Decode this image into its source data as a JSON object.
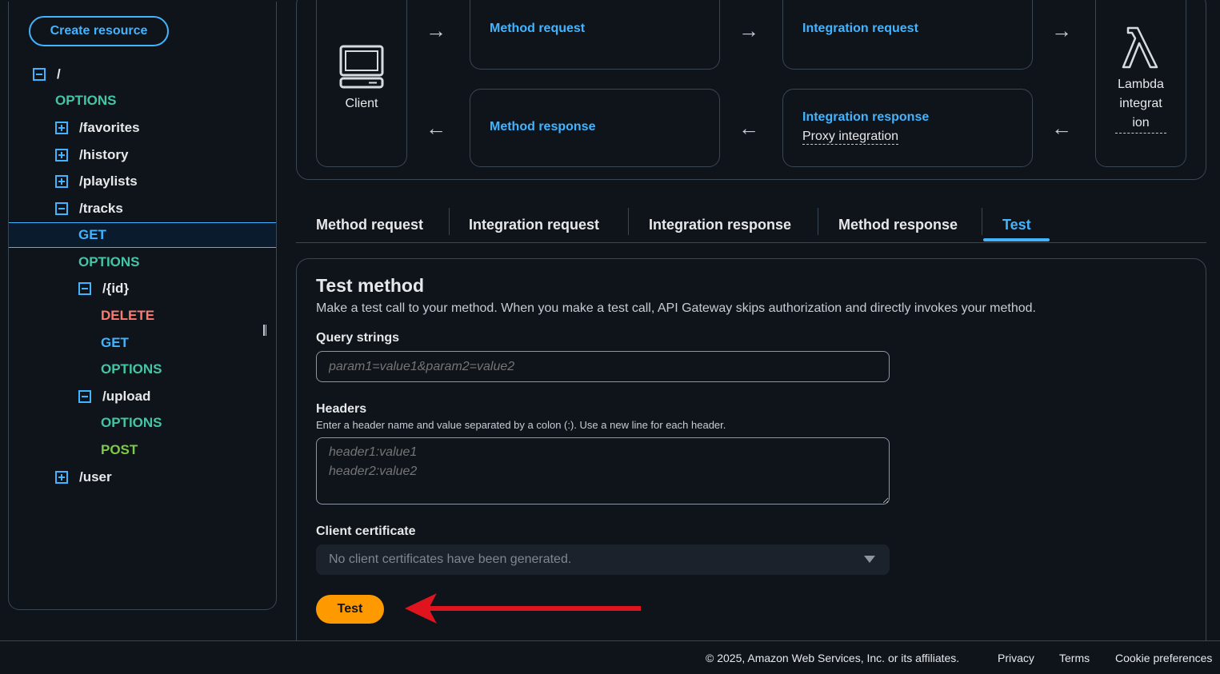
{
  "sidebar": {
    "create_resource": "Create resource",
    "tree": [
      {
        "kind": "path",
        "label": "/",
        "toggle": "minus"
      },
      {
        "kind": "method",
        "label": "OPTIONS",
        "method": "options"
      },
      {
        "kind": "path",
        "label": "/favorites",
        "toggle": "plus"
      },
      {
        "kind": "path",
        "label": "/history",
        "toggle": "plus"
      },
      {
        "kind": "path",
        "label": "/playlists",
        "toggle": "plus"
      },
      {
        "kind": "path",
        "label": "/tracks",
        "toggle": "minus"
      },
      {
        "kind": "method",
        "label": "GET",
        "method": "get",
        "selected": true
      },
      {
        "kind": "method",
        "label": "OPTIONS",
        "method": "options"
      },
      {
        "kind": "path",
        "label": "/{id}",
        "toggle": "minus"
      },
      {
        "kind": "method",
        "label": "DELETE",
        "method": "delete"
      },
      {
        "kind": "method",
        "label": "GET",
        "method": "get"
      },
      {
        "kind": "method",
        "label": "OPTIONS",
        "method": "options"
      },
      {
        "kind": "path",
        "label": "/upload",
        "toggle": "minus"
      },
      {
        "kind": "method",
        "label": "OPTIONS",
        "method": "options"
      },
      {
        "kind": "method",
        "label": "POST",
        "method": "post"
      },
      {
        "kind": "path",
        "label": "/user",
        "toggle": "plus"
      }
    ]
  },
  "flow": {
    "client": "Client",
    "method_request": "Method request",
    "integration_request": "Integration request",
    "method_response": "Method response",
    "integration_response": "Integration response",
    "proxy_integration": "Proxy integration",
    "lambda_line1": "Lambda",
    "lambda_line2": "integrat",
    "lambda_line3": "ion"
  },
  "tabs": [
    {
      "label": "Method request"
    },
    {
      "label": "Integration request"
    },
    {
      "label": "Integration response"
    },
    {
      "label": "Method response"
    },
    {
      "label": "Test",
      "active": true
    }
  ],
  "test_method": {
    "title": "Test method",
    "description": "Make a test call to your method. When you make a test call, API Gateway skips authorization and directly invokes your method.",
    "query_label": "Query strings",
    "query_placeholder": "param1=value1&param2=value2",
    "headers_label": "Headers",
    "headers_hint": "Enter a header name and value separated by a colon (:). Use a new line for each header.",
    "headers_placeholder": "header1:value1\nheader2:value2",
    "cert_label": "Client certificate",
    "cert_value": "No client certificates have been generated.",
    "test_button": "Test"
  },
  "footer": {
    "copyright": "© 2025, Amazon Web Services, Inc. or its affiliates.",
    "privacy": "Privacy",
    "terms": "Terms",
    "cookies": "Cookie preferences"
  },
  "colors": {
    "accent": "#42b4ff",
    "options": "#44c6a4",
    "delete": "#ff7a6e",
    "post": "#7ec94b",
    "primary_button": "#ff9900",
    "annotation_arrow": "#e0141e"
  }
}
